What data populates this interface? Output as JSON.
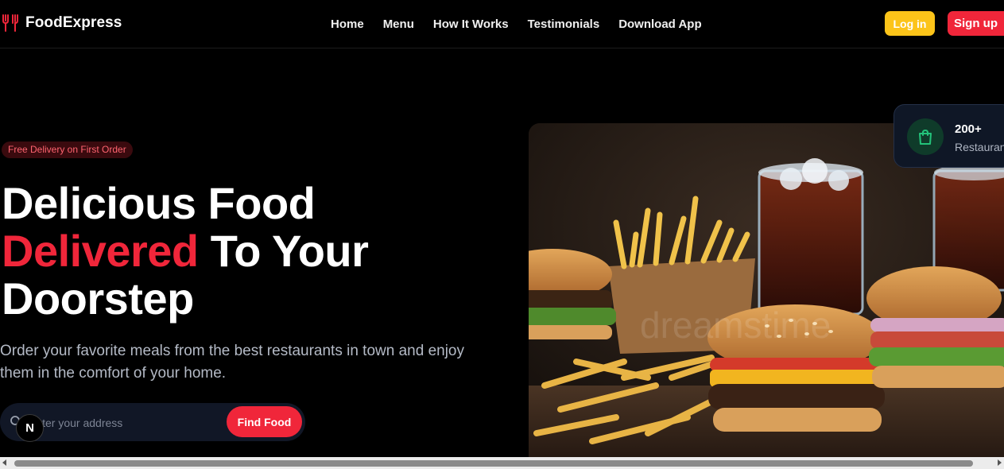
{
  "nav": {
    "brand": "FoodExpress",
    "logo_icon": "utensils-icon",
    "links": [
      "Home",
      "Menu",
      "How It Works",
      "Testimonials",
      "Download App"
    ],
    "login_label": "Log in",
    "signup_label": "Sign up"
  },
  "hero": {
    "badge": "Free Delivery on First Order",
    "headline_line1": "Delicious Food",
    "headline_accent": "Delivered",
    "headline_line2_rest": " To Your",
    "headline_line3": "Doorstep",
    "subtext": "Order your favorite meals from the best restaurants in town and enjoy them in the comfort of your home.",
    "search_placeholder": "Enter your address",
    "search_icon": "search-icon",
    "find_button": "Find Food",
    "image_alt": "Burgers, fries and cola",
    "watermark": "dreamstime"
  },
  "stats": {
    "value": "200+",
    "label": "Restaurants",
    "icon": "shopping-bag-icon"
  },
  "overlay": {
    "avatar_letter": "N"
  },
  "colors": {
    "accent": "#f0263a",
    "login": "#fcc419",
    "background": "#000000"
  }
}
